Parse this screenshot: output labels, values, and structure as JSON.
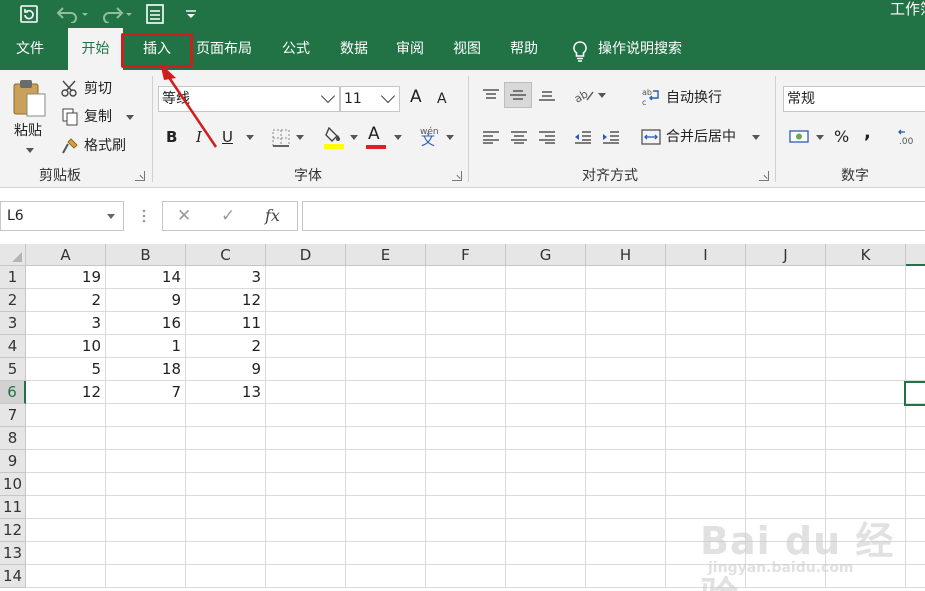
{
  "app": {
    "workbook_title": "工作簿"
  },
  "colors": {
    "accent": "#217346",
    "highlight": "#d21d1d"
  },
  "quick_access": [
    "save-refresh-icon",
    "undo-icon",
    "redo-icon",
    "form-icon",
    "customize-icon"
  ],
  "menu": {
    "tabs": [
      "文件",
      "开始",
      "插入",
      "页面布局",
      "公式",
      "数据",
      "审阅",
      "视图",
      "帮助"
    ],
    "active_tab": "开始",
    "highlighted_tab": "插入",
    "tell_me": "操作说明搜索"
  },
  "ribbon": {
    "clipboard": {
      "paste": "粘贴",
      "cut": "剪切",
      "copy": "复制",
      "format_painter": "格式刷",
      "label": "剪贴板"
    },
    "font": {
      "name": "等线",
      "size": "11",
      "bold": "B",
      "italic": "I",
      "underline": "U",
      "grow": "A",
      "shrink": "A",
      "font_color": "A",
      "phonetic": "文",
      "phonetic_top": "wén",
      "label": "字体"
    },
    "alignment": {
      "wrap": "自动换行",
      "merge": "合并后居中",
      "label": "对齐方式"
    },
    "number": {
      "format": "常规",
      "percent": "%",
      "comma": ",",
      "label": "数字"
    }
  },
  "formula_bar": {
    "name_box": "L6",
    "cancel": "✕",
    "enter": "✓",
    "fx": "fx",
    "value": ""
  },
  "sheet": {
    "columns": [
      "A",
      "B",
      "C",
      "D",
      "E",
      "F",
      "G",
      "H",
      "I",
      "J",
      "K"
    ],
    "rows": [
      "1",
      "2",
      "3",
      "4",
      "5",
      "6",
      "7",
      "8",
      "9",
      "10",
      "11",
      "12",
      "13",
      "14"
    ],
    "values": [
      [
        "19",
        "14",
        "3"
      ],
      [
        "2",
        "9",
        "12"
      ],
      [
        "3",
        "16",
        "11"
      ],
      [
        "10",
        "1",
        "2"
      ],
      [
        "5",
        "18",
        "9"
      ],
      [
        "12",
        "7",
        "13"
      ]
    ],
    "selected_row": "6"
  },
  "watermark": {
    "text": "Bai du 经验",
    "url": "jingyan.baidu.com"
  }
}
